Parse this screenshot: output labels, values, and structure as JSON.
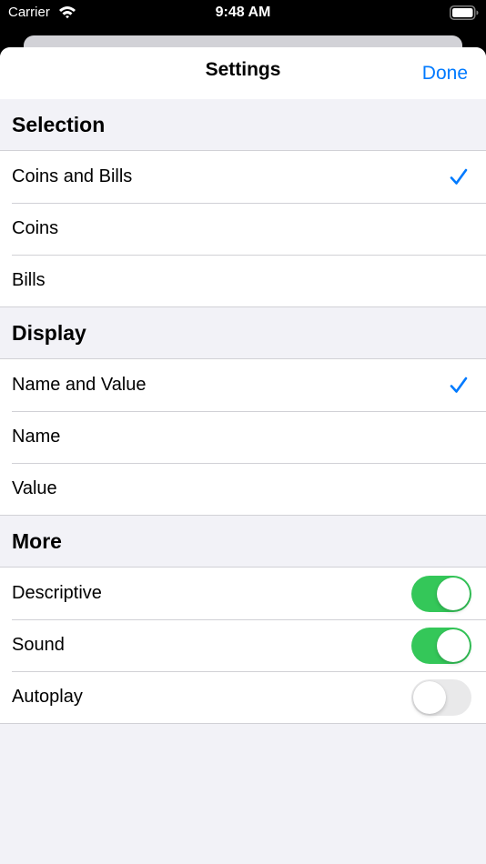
{
  "status_bar": {
    "carrier": "Carrier",
    "time": "9:48 AM"
  },
  "nav": {
    "title": "Settings",
    "done_label": "Done"
  },
  "sections": {
    "selection": {
      "header": "Selection",
      "items": [
        {
          "label": "Coins and Bills",
          "checked": true
        },
        {
          "label": "Coins",
          "checked": false
        },
        {
          "label": "Bills",
          "checked": false
        }
      ]
    },
    "display": {
      "header": "Display",
      "items": [
        {
          "label": "Name and Value",
          "checked": true
        },
        {
          "label": "Name",
          "checked": false
        },
        {
          "label": "Value",
          "checked": false
        }
      ]
    },
    "more": {
      "header": "More",
      "items": [
        {
          "label": "Descriptive",
          "enabled": true
        },
        {
          "label": "Sound",
          "enabled": true
        },
        {
          "label": "Autoplay",
          "enabled": false
        }
      ]
    }
  },
  "colors": {
    "accent": "#007aff",
    "toggle_on": "#34c759",
    "toggle_off": "#e9e9ea",
    "grouped_background": "#f2f2f7"
  }
}
